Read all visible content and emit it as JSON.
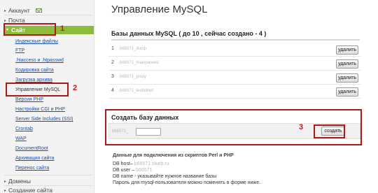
{
  "sidebar": {
    "account": "Аккаунт",
    "mail": "Почта",
    "site": "Сайт",
    "links": [
      "Индексные файлы",
      "FTP",
      ".htaccess и .htpasswd",
      "Кодировка сайта",
      "Загрузка архива",
      "Управление MySQL",
      "Версия PHP",
      "Настройки CGI и PHP",
      "Server Side Includes (SSI)",
      "Crontab",
      "WAP",
      "DocumentRoot",
      "Архивация сайта",
      "Перенос сайта"
    ],
    "domains": "Домены",
    "create_site": "Создание сайта"
  },
  "annotations": {
    "one": "1",
    "two": "2",
    "three": "3"
  },
  "main": {
    "title": "Управление MySQL",
    "db_heading": "Базы данных MySQL ( до 10 , сейчас создано - 4 )",
    "databases": [
      {
        "num": "1",
        "name": "b66571_dump",
        "button": "удалить"
      },
      {
        "num": "2",
        "name": "b66571_mainpanelst",
        "button": "удалить"
      },
      {
        "num": "3",
        "name": "b66571_proxy",
        "button": "удалить"
      },
      {
        "num": "4",
        "name": "b66571_testbdnet",
        "button": "удалить"
      }
    ],
    "create": {
      "title": "Создать базу данных",
      "prefix": "b66571_",
      "input_value": "",
      "button": "создать"
    },
    "info": {
      "title": "Данные для подключения из скриптов Perl и PHP",
      "host_label": "DB host–",
      "host_value": "b66571.sweb.ru",
      "user_label": "DB user –",
      "user_value": "b66571",
      "db_line": "DB name - указывайте нужное название базы",
      "pwd_line": "Пароль для mysql-пользователя можно поменять в форме ниже."
    }
  },
  "colors": {
    "accent_green": "#8dbb3a",
    "link_blue": "#1c4fa8",
    "annotation_red": "#c81515"
  }
}
